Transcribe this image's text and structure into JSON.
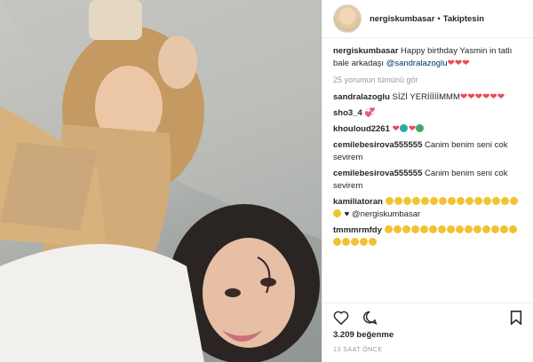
{
  "post": {
    "username": "nergiskumbasar",
    "follow": "Takiptesin",
    "caption_user": "nergiskumbasar",
    "caption": "Happy birthday Yasmin in tatlı bale arkadaşı",
    "caption_mention": "@sandralazoglu",
    "more_comments": "25 yorumun tümünü gör",
    "likes": "3.209 beğenme",
    "time": "13 SAAT ÖNCE"
  },
  "comments": [
    {
      "user": "sandralazoglu",
      "text": "SİZİ YERİİİİİMMM"
    },
    {
      "user": "sho3_4",
      "text": ""
    },
    {
      "user": "khouloud2261",
      "text": ""
    },
    {
      "user": "cemilebesirova555555",
      "text": "Canim benim seni cok sevirem"
    },
    {
      "user": "cemilebesirova555555",
      "text": "Canim benim seni cok sevirem"
    },
    {
      "user": "kamiliatoran",
      "text": ""
    },
    {
      "user": "tmmmrmfdy",
      "text": ""
    }
  ],
  "kamiliatoran_mention": "@nergiskumbasar",
  "icons": [
    "heart-icon",
    "comment-icon",
    "share-icon",
    "bookmark-icon"
  ]
}
